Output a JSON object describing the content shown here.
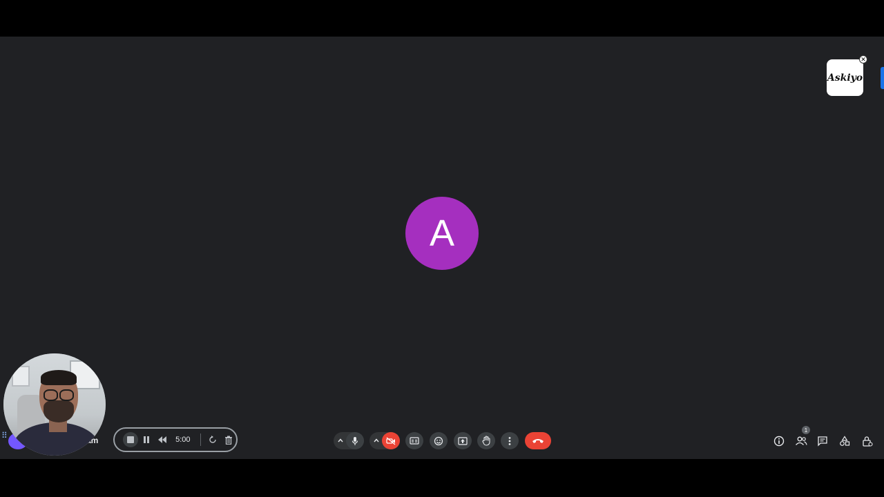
{
  "stage": {
    "avatar_initial": "A",
    "avatar_color": "#a52fbf",
    "background": "#202124"
  },
  "brand": {
    "logo_text": "Askiyo",
    "close_icon": "close-icon"
  },
  "self_view": {
    "name_fragment": "am"
  },
  "recorder": {
    "time": "5:00",
    "icons": [
      "stop-icon",
      "pause-icon",
      "rewind-icon",
      "restart-icon",
      "trash-icon"
    ]
  },
  "controls": {
    "icons": [
      "chevron-up-icon",
      "mic-icon",
      "chevron-up-icon",
      "camera-off-icon",
      "captions-icon",
      "emoji-icon",
      "present-icon",
      "raise-hand-icon",
      "more-icon",
      "end-call-icon"
    ],
    "end_call_color": "#ea4335"
  },
  "side_controls": {
    "icons": [
      "info-icon",
      "people-icon",
      "chat-icon",
      "activities-icon",
      "host-controls-icon"
    ],
    "people_count": "1"
  }
}
